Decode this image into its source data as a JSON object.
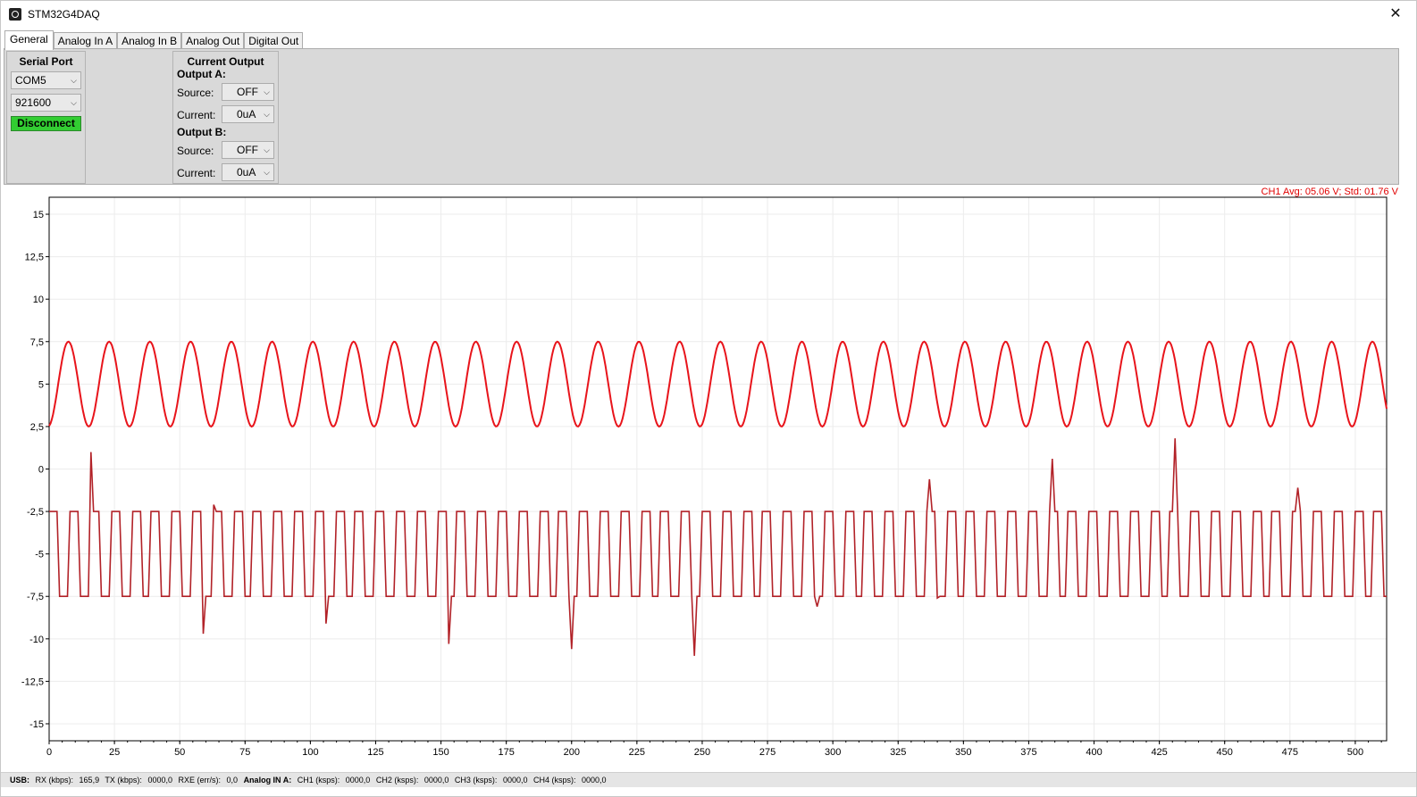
{
  "window": {
    "title": "STM32G4DAQ",
    "close_glyph": "✕",
    "icon": "app-logo-icon"
  },
  "tabs": [
    {
      "label": "General",
      "active": true
    },
    {
      "label": "Analog In A",
      "active": false
    },
    {
      "label": "Analog In B",
      "active": false
    },
    {
      "label": "Analog Out",
      "active": false
    },
    {
      "label": "Digital Out",
      "active": false
    }
  ],
  "serial": {
    "title": "Serial Port",
    "port": "COM5",
    "baud": "921600",
    "button": "Disconnect",
    "button_color": "#32cd32"
  },
  "current_output": {
    "title": "Current Output",
    "a": {
      "heading": "Output A:",
      "source_label": "Source:",
      "source": "OFF",
      "current_label": "Current:",
      "current": "0uA"
    },
    "b": {
      "heading": "Output B:",
      "source_label": "Source:",
      "source": "OFF",
      "current_label": "Current:",
      "current": "0uA"
    }
  },
  "stats": "CH1 Avg: 05.06 V; Std: 01.76 V",
  "status": {
    "usb_key": "USB:",
    "rx_label": "RX (kbps):",
    "rx": "165,9",
    "tx_label": "TX (kbps):",
    "tx": "0000,0",
    "rxe_label": "RXE (err/s):",
    "rxe": "0,0",
    "ain_key": "Analog IN A:",
    "ch1_label": "CH1 (ksps):",
    "ch1": "0000,0",
    "ch2_label": "CH2 (ksps):",
    "ch2": "0000,0",
    "ch3_label": "CH3 (ksps):",
    "ch3": "0000,0",
    "ch4_label": "CH4 (ksps):",
    "ch4": "0000,0"
  },
  "chart_data": {
    "type": "line",
    "xlim": [
      0,
      512
    ],
    "ylim": [
      -16,
      16
    ],
    "xticks": [
      0,
      25,
      50,
      75,
      100,
      125,
      150,
      175,
      200,
      225,
      250,
      275,
      300,
      325,
      350,
      375,
      400,
      425,
      450,
      475,
      500
    ],
    "yticks": [
      15,
      12.5,
      10,
      7.5,
      5,
      2.5,
      0,
      -2.5,
      -5,
      -7.5,
      -10,
      -12.5,
      -15
    ],
    "ytick_labels": [
      "15",
      "12,5",
      "10",
      "7,5",
      "5",
      "2,5",
      "0",
      "-2,5",
      "-5",
      "-7,5",
      "-10",
      "-12,5",
      "-15"
    ],
    "grid": true,
    "series": [
      {
        "color": "#e8141b",
        "kind": "sine",
        "offset": 5.0,
        "amplitude": 2.5,
        "period": 15.6,
        "phase_deg": -80
      },
      {
        "color": "#b22228",
        "kind": "square",
        "high": -2.5,
        "low": -7.5,
        "period": 7.8,
        "spikes": [
          {
            "x": 16,
            "y": 1.0
          },
          {
            "x": 59,
            "y": -9.7
          },
          {
            "x": 63,
            "y": -2.1
          },
          {
            "x": 106,
            "y": -9.1
          },
          {
            "x": 153,
            "y": -10.3
          },
          {
            "x": 200,
            "y": -10.6
          },
          {
            "x": 247,
            "y": -11.0
          },
          {
            "x": 294,
            "y": -8.1
          },
          {
            "x": 337,
            "y": -0.6
          },
          {
            "x": 340,
            "y": -7.6
          },
          {
            "x": 384,
            "y": 0.6
          },
          {
            "x": 431,
            "y": 1.8
          },
          {
            "x": 478,
            "y": -1.1
          }
        ]
      }
    ]
  }
}
